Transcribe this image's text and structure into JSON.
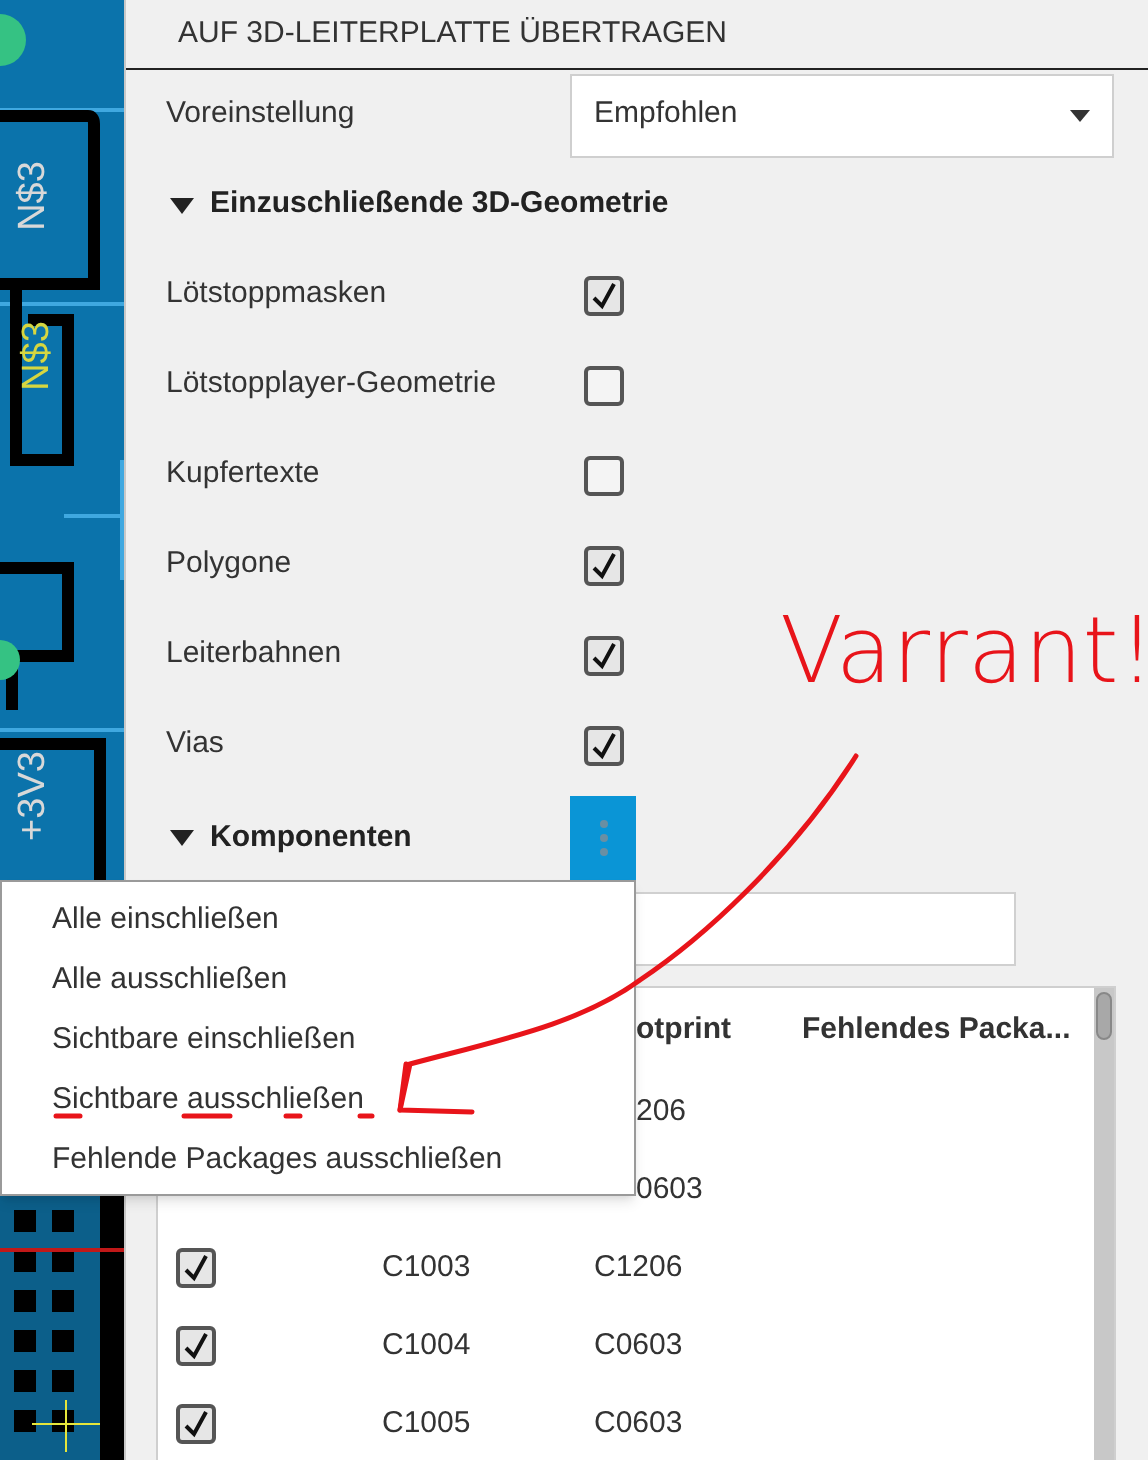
{
  "canvas": {
    "labels": [
      "N$3",
      "N$3",
      "+3V3"
    ]
  },
  "title": "AUF 3D-LEITERPLATTE ÜBERTRAGEN",
  "preset": {
    "label": "Voreinstellung",
    "value": "Empfohlen"
  },
  "geometry_section": {
    "title": "Einzuschließende 3D-Geometrie",
    "expanded": true,
    "items": [
      {
        "label": "Lötstoppmasken",
        "checked": true
      },
      {
        "label": "Lötstopplayer-Geometrie",
        "checked": false
      },
      {
        "label": "Kupfertexte",
        "checked": false
      },
      {
        "label": "Polygone",
        "checked": true
      },
      {
        "label": "Leiterbahnen",
        "checked": true
      },
      {
        "label": "Vias",
        "checked": true
      }
    ]
  },
  "components_section": {
    "title": "Komponenten",
    "expanded": true
  },
  "table": {
    "columns": [
      "otprint",
      "Fehlendes Packa..."
    ],
    "rows": [
      {
        "footprint": "206"
      },
      {
        "footprint": "0603"
      },
      {
        "checked": true,
        "name": "C1003",
        "footprint": "C1206"
      },
      {
        "checked": true,
        "name": "C1004",
        "footprint": "C0603"
      },
      {
        "checked": true,
        "name": "C1005",
        "footprint": "C0603"
      }
    ]
  },
  "context_menu": {
    "items": [
      "Alle einschließen",
      "Alle ausschließen",
      "Sichtbare einschließen",
      "Sichtbare ausschließen",
      "Fehlende Packages ausschließen"
    ]
  },
  "annotation": {
    "text": "Varrant!"
  }
}
